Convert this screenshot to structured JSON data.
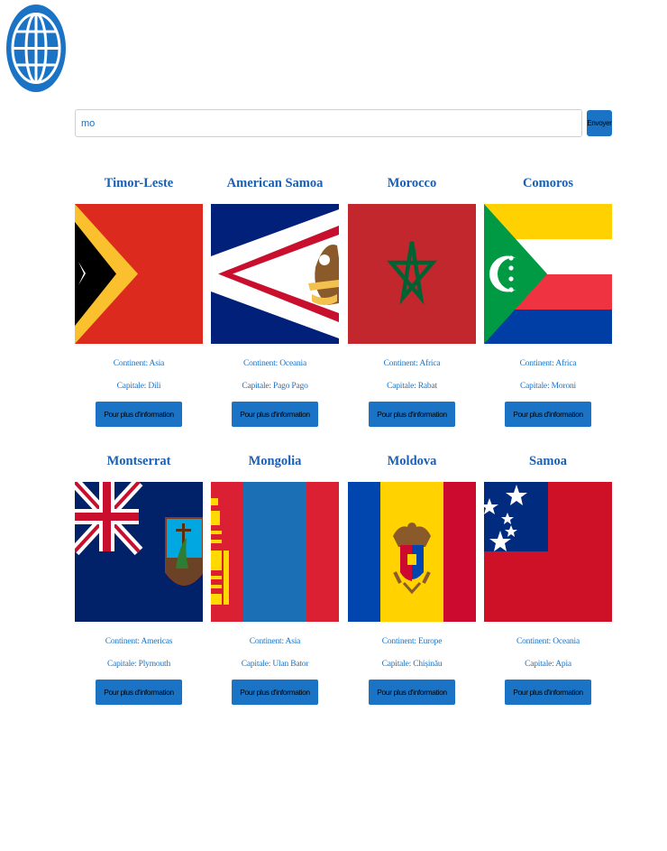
{
  "header": {
    "logo_icon": "globe-icon",
    "accent": "#1a73c5"
  },
  "search": {
    "value": "mo",
    "button_label": "Envoyer"
  },
  "countries": [
    {
      "name": "Timor-Leste",
      "continent": "Continent: Asia",
      "capital": "Capitale: Dili",
      "button": "Pour plus d'information",
      "flag": "timor-leste-flag"
    },
    {
      "name": "American Samoa",
      "continent": "Continent: Oceania",
      "capital": "Capitale: Pago Pago",
      "button": "Pour plus d'information",
      "flag": "american-samoa-flag"
    },
    {
      "name": "Morocco",
      "continent": "Continent: Africa",
      "capital": "Capitale: Rabat",
      "button": "Pour plus d'information",
      "flag": "morocco-flag"
    },
    {
      "name": "Comoros",
      "continent": "Continent: Africa",
      "capital": "Capitale: Moroni",
      "button": "Pour plus d'information",
      "flag": "comoros-flag"
    },
    {
      "name": "Montserrat",
      "continent": "Continent: Americas",
      "capital": "Capitale: Plymouth",
      "button": "Pour plus d'information",
      "flag": "montserrat-flag"
    },
    {
      "name": "Mongolia",
      "continent": "Continent: Asia",
      "capital": "Capitale: Ulan Bator",
      "button": "Pour plus d'information",
      "flag": "mongolia-flag"
    },
    {
      "name": "Moldova",
      "continent": "Continent: Europe",
      "capital": "Capitale: Chișinău",
      "button": "Pour plus d'information",
      "flag": "moldova-flag"
    },
    {
      "name": "Samoa",
      "continent": "Continent: Oceania",
      "capital": "Capitale: Apia",
      "button": "Pour plus d'information",
      "flag": "samoa-flag"
    }
  ]
}
